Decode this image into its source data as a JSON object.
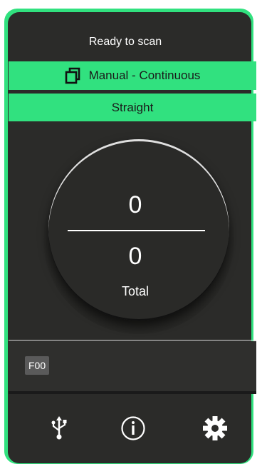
{
  "status": {
    "text": "Ready to scan"
  },
  "scan_mode": {
    "label": "Manual - Continuous",
    "icon": "copy-pages-icon"
  },
  "feed_mode": {
    "label": "Straight"
  },
  "counter": {
    "current": "0",
    "total": "0",
    "total_label": "Total"
  },
  "error": {
    "code": "F00"
  },
  "toolbar": {
    "usb_icon": "usb-icon",
    "info_icon": "info-icon",
    "settings_icon": "gear-icon"
  },
  "colors": {
    "accent": "#31e17f",
    "panel": "#2b2b29",
    "text": "#ffffff"
  }
}
